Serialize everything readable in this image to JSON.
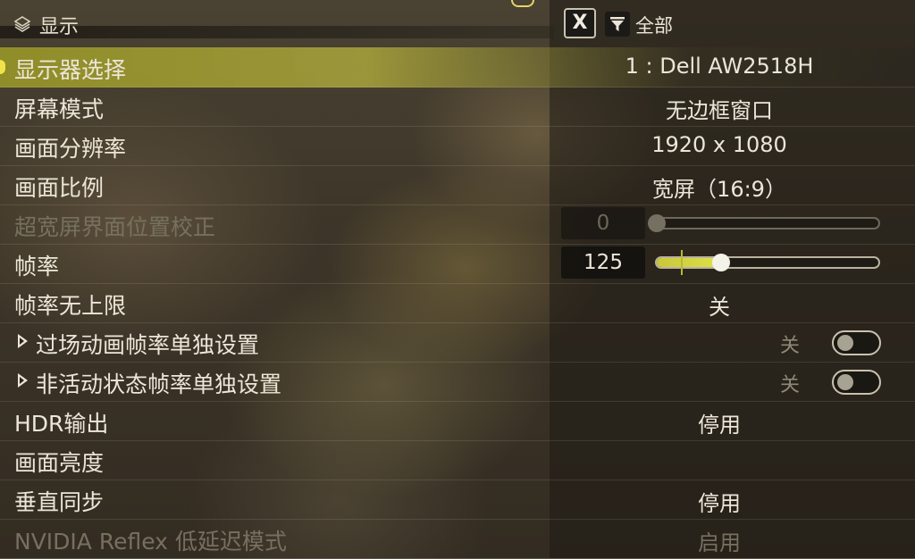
{
  "header": {
    "title": "显示",
    "icon": "settings-layers-icon",
    "close_button": "X",
    "filter_label": "全部"
  },
  "rows": [
    {
      "label": "显示器选择",
      "value": "1 : Dell AW2518H"
    },
    {
      "label": "屏幕模式",
      "value": "无边框窗口"
    },
    {
      "label": "画面分辨率",
      "value": "1920 x 1080"
    },
    {
      "label": "画面比例",
      "value": "宽屏（16:9）"
    },
    {
      "label": "超宽屏界面位置校正",
      "value": "0",
      "slider_fraction": 0.0
    },
    {
      "label": "帧率",
      "value": "125",
      "slider_fraction": 0.29
    },
    {
      "label": "帧率无上限",
      "value": "关"
    },
    {
      "label": "过场动画帧率单独设置",
      "value": "关"
    },
    {
      "label": "非活动状态帧率单独设置",
      "value": "关"
    },
    {
      "label": "HDR输出",
      "value": "停用"
    },
    {
      "label": "画面亮度",
      "value": ""
    },
    {
      "label": "垂直同步",
      "value": "停用"
    },
    {
      "label": "NVIDIA Reflex 低延迟模式",
      "value": "启用"
    }
  ],
  "colors": {
    "highlight": "#c8c83a",
    "text": "#ece6d8",
    "disabled_text": "#77705f"
  }
}
